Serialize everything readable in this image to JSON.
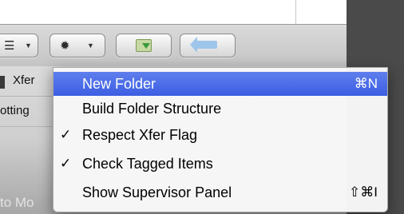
{
  "toolbar": {
    "view_icon": "list-view-icon",
    "gear_icon": "gear-icon",
    "folder_icon": "folder-download-icon",
    "back_icon": "back-arrow-icon",
    "caret_icon": "chevron-down-icon"
  },
  "background": {
    "row1_text": "Xfer",
    "row2_text": "otting",
    "bottom_text": "to Mo"
  },
  "menu": {
    "items": [
      {
        "label": "New Folder",
        "shortcut": "⌘N",
        "checked": false,
        "highlighted": true
      },
      {
        "label": "Build Folder Structure",
        "shortcut": "",
        "checked": false,
        "highlighted": false
      },
      {
        "label": "Respect Xfer Flag",
        "shortcut": "",
        "checked": true,
        "check_mark": "✓",
        "highlighted": false
      },
      {
        "label": "Check Tagged Items",
        "shortcut": "",
        "checked": true,
        "check_mark": "✓",
        "highlighted": false
      },
      {
        "label": "Show Supervisor Panel",
        "shortcut": "⇧⌘I",
        "checked": false,
        "highlighted": false
      }
    ]
  },
  "colors": {
    "highlight": "#4a6ae8",
    "menu_bg": "#f7f7f7",
    "window_dark": "#4a4a4a"
  }
}
